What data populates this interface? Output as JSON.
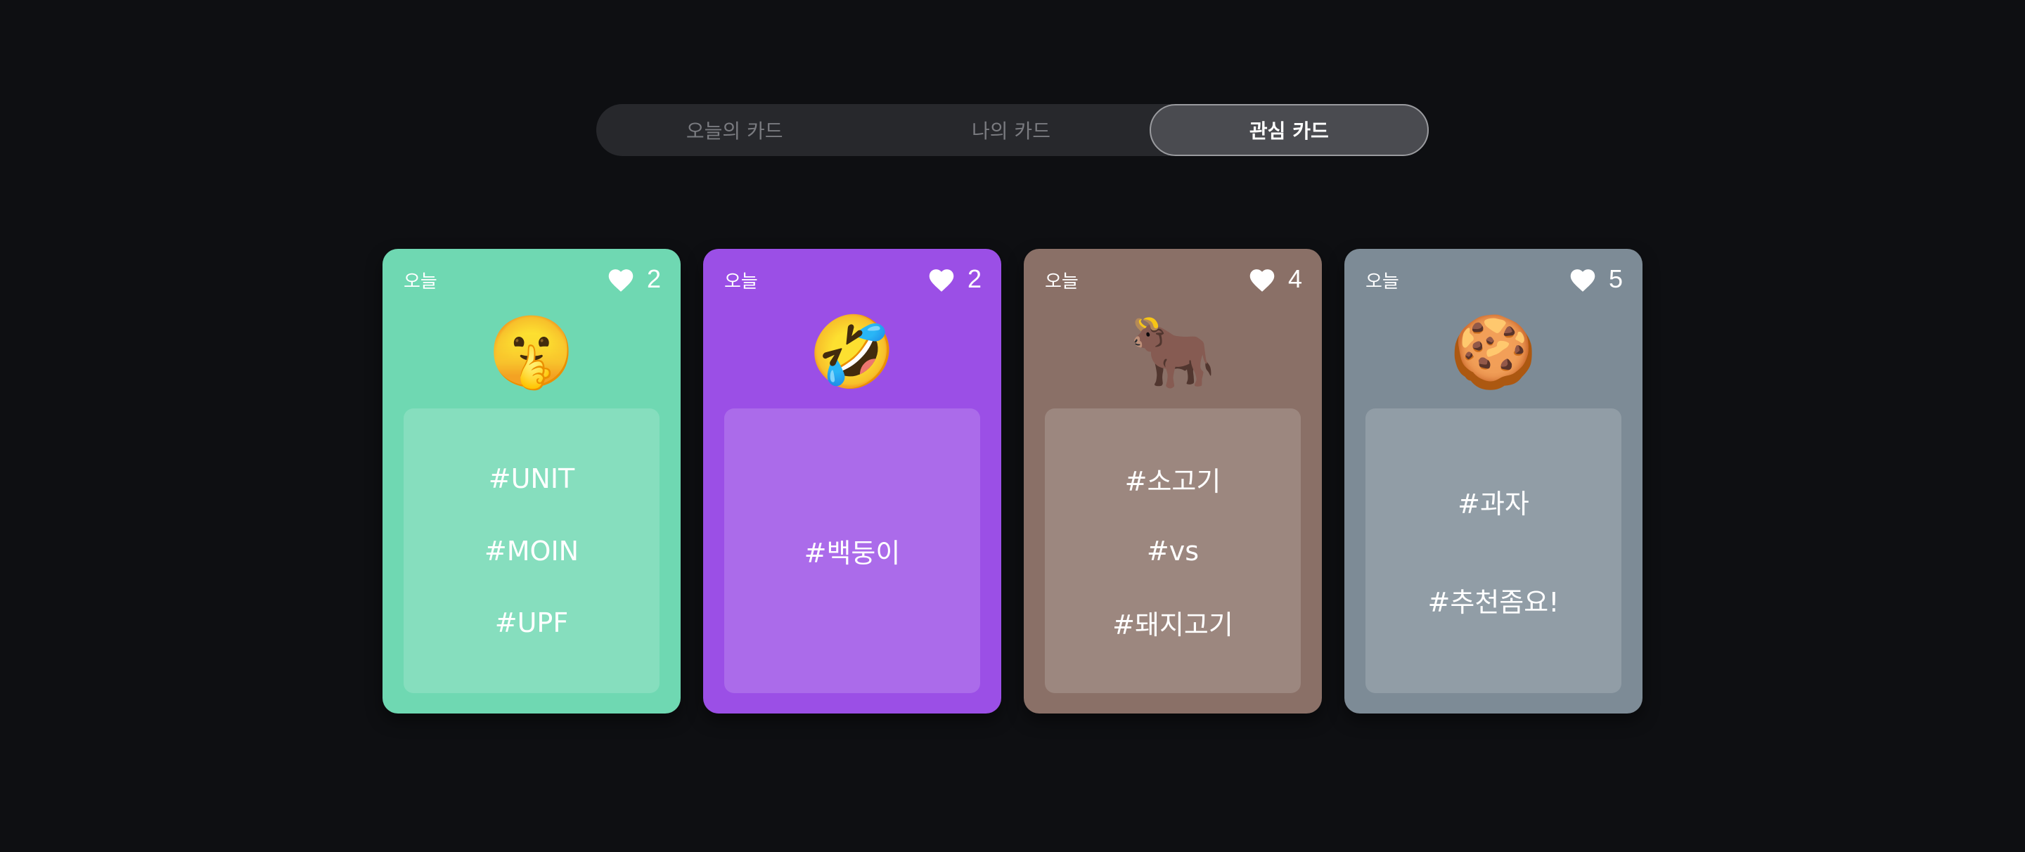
{
  "tabs": [
    {
      "label": "오늘의 카드",
      "active": false
    },
    {
      "label": "나의 카드",
      "active": false
    },
    {
      "label": "관심 카드",
      "active": true
    }
  ],
  "cards": [
    {
      "label": "오늘",
      "likes": "2",
      "emoji": "🤫",
      "color": "#6fd8b2",
      "tags": [
        "#UNIT",
        "#MOIN",
        "#UPF"
      ]
    },
    {
      "label": "오늘",
      "likes": "2",
      "emoji": "🤣",
      "color": "#9b4fe6",
      "tags": [
        "#백둥이"
      ]
    },
    {
      "label": "오늘",
      "likes": "4",
      "emoji": "🐂",
      "color": "#8a7067",
      "tags": [
        "#소고기",
        "#vs",
        "#돼지고기"
      ]
    },
    {
      "label": "오늘",
      "likes": "5",
      "emoji": "🍪",
      "color": "#7d8b96",
      "tags": [
        "#과자",
        "#추천좀요!"
      ]
    }
  ],
  "icons": {
    "like": "heart-icon"
  }
}
